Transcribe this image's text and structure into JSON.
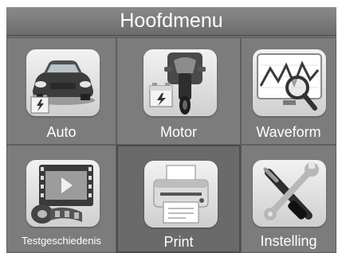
{
  "title": "Hoofdmenu",
  "tiles": [
    {
      "label": "Auto",
      "icon": "car-icon"
    },
    {
      "label": "Motor",
      "icon": "motorcycle-icon"
    },
    {
      "label": "Waveform",
      "icon": "waveform-icon"
    },
    {
      "label": "Testgeschiedenis",
      "icon": "film-icon"
    },
    {
      "label": "Print",
      "icon": "printer-icon"
    },
    {
      "label": "Instelling",
      "icon": "tools-icon"
    }
  ],
  "colors": {
    "background": "#6e6e6e",
    "tile": "#7c7c7c",
    "text": "#ffffff"
  }
}
